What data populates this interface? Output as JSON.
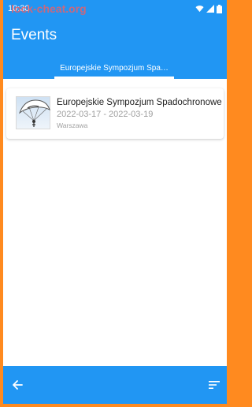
{
  "status_bar": {
    "time": "10:30",
    "icons": [
      "wifi-icon",
      "signal-icon",
      "battery-icon"
    ]
  },
  "watermark": "lock-cheat.org",
  "app_bar": {
    "title": "Events",
    "tabs": [
      {
        "label": "Europejskie Sympozjum Spa…",
        "selected": true
      }
    ]
  },
  "events": [
    {
      "name": "Europejskie Sympozjum Spadochronowe",
      "dates": "2022-03-17 - 2022-03-19",
      "city": "Warszawa",
      "thumbnail_icon": "parachute-photo"
    }
  ],
  "bottom_bar": {
    "icons": [
      "arrow-back-icon",
      "sort-icon"
    ]
  },
  "colors": {
    "primary": "#2196f3",
    "frame": "#ff8a1f",
    "surface": "#ffffff",
    "secondary_text": "#9e9e9e"
  }
}
